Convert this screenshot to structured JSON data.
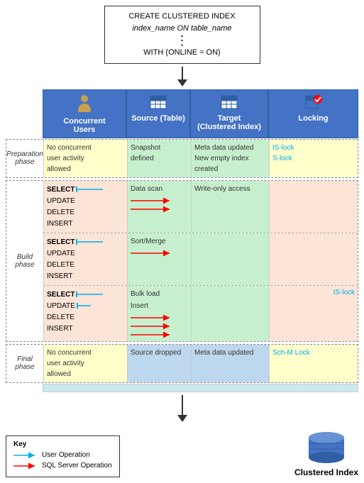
{
  "sql_box": {
    "line1": "CREATE CLUSTERED INDEX",
    "line2": "index_name ON table_name",
    "dots": "⋮",
    "line3": "WITH (ONLINE = ON)"
  },
  "headers": {
    "concurrent_users": "Concurrent\nUsers",
    "source_table": "Source (Table)",
    "target": "Target\n(Clustered Index)",
    "locking": "Locking"
  },
  "phases": {
    "preparation": {
      "label": "Preparation\nphase",
      "concurrent": "No concurrent\nuser activity\nallowed",
      "source": "Snapshot\ndefined",
      "target": "Meta data updated\nNew empty index\ncreated",
      "locking": "IS-lock\nS-lock"
    },
    "build": {
      "label": "Build\nphase",
      "sub1": {
        "ops": "SELECT\nUPDATE\nDELETE\nINSERT",
        "source": "Data scan",
        "target": "Write-only access",
        "locking": ""
      },
      "sub2": {
        "ops": "SELECT\nUPDATE\nDELETE\nINSERT",
        "source": "Sort/Merge",
        "target": "",
        "locking": ""
      },
      "sub3": {
        "ops": "SELECT\nUPDATE\nDELETE\nINSERT",
        "source": "Bulk load\nInsert",
        "target": "",
        "locking": "IS-lock"
      }
    },
    "final": {
      "label": "Final\nphase",
      "concurrent": "No concurrent\nuser activity\nallowed",
      "source": "Source dropped",
      "target": "Meta data updated",
      "locking": "Sch-M Lock"
    }
  },
  "key": {
    "title": "Key",
    "user_op": "User Operation",
    "sql_op": "SQL Server Operation"
  },
  "bottom_label": "Clustered Index"
}
